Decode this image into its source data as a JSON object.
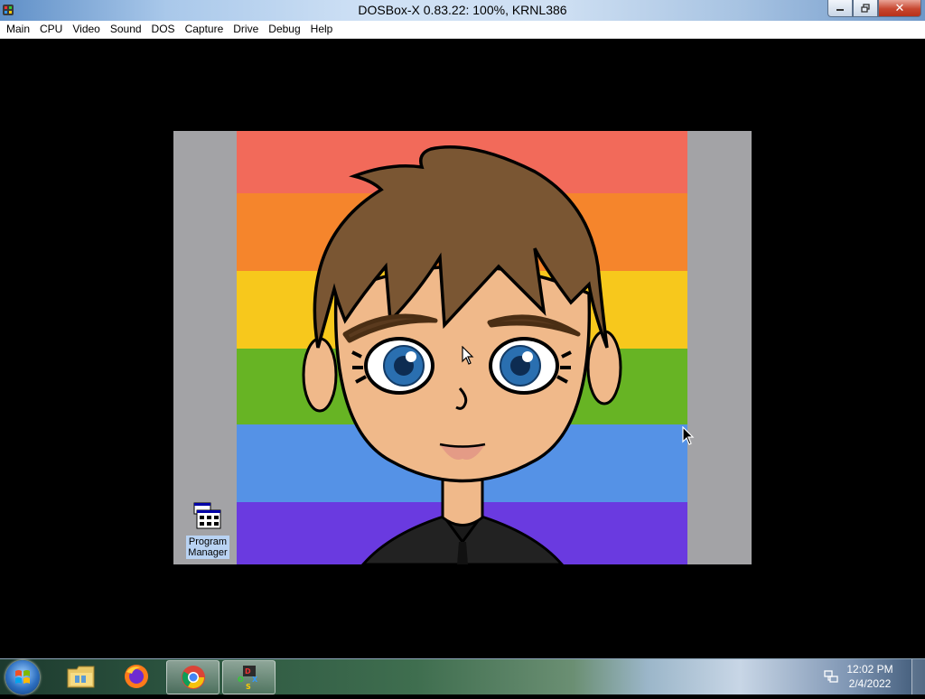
{
  "window": {
    "title": "DOSBox-X 0.83.22: 100%, KRNL386",
    "buttons": {
      "minimize_icon": "minimize-icon",
      "restore_icon": "restore-icon",
      "close_label": "✕"
    }
  },
  "menubar": {
    "items": [
      "Main",
      "CPU",
      "Video",
      "Sound",
      "DOS",
      "Capture",
      "Drive",
      "Debug",
      "Help"
    ]
  },
  "desktop": {
    "wallpaper_stripes": [
      "#f26a5a",
      "#f5852c",
      "#f7c81c",
      "#67b424",
      "#5592e6",
      "#6a3ae0"
    ],
    "icon": {
      "label_line1": "Program",
      "label_line2": "Manager",
      "icon_name": "program-manager-icon"
    }
  },
  "taskbar": {
    "start_icon": "windows-start-orb",
    "pinned": [
      {
        "name": "file-explorer-icon",
        "active": false
      },
      {
        "name": "firefox-icon",
        "active": false
      },
      {
        "name": "chrome-icon",
        "active": true
      },
      {
        "name": "dosbox-icon",
        "active": true
      }
    ],
    "clock": {
      "time": "12:02 PM",
      "date": "2/4/2022"
    },
    "tray_icon": "network-icon"
  }
}
